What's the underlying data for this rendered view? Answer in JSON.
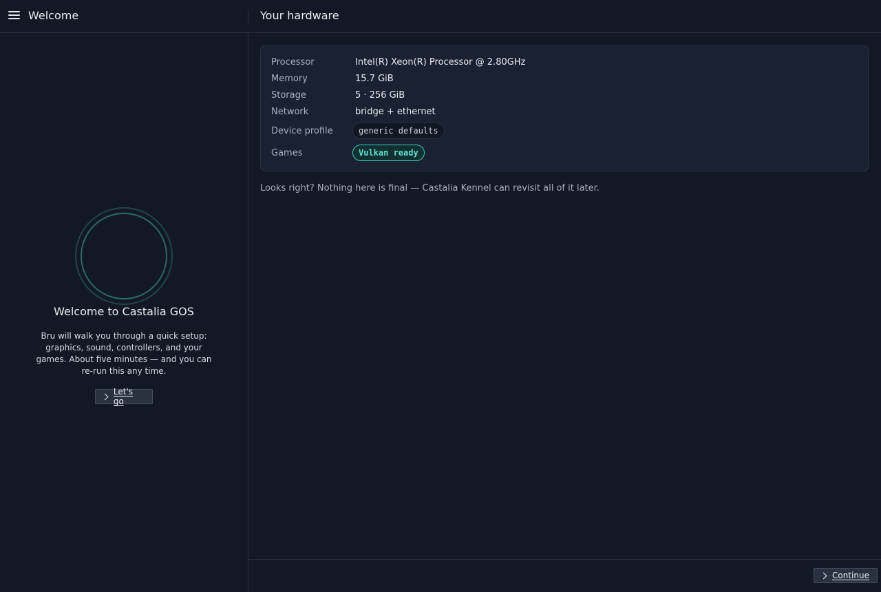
{
  "header": {
    "left_title": "Welcome",
    "right_title": "Your hardware"
  },
  "sidebar": {
    "title": "Welcome to Castalia GOS",
    "description": "Bru will walk you through a quick setup: graphics, sound, controllers, and your games. About five minutes — and you can re-run this any time.",
    "button_label": "Let's go"
  },
  "hardware": {
    "rows": [
      {
        "label": "Processor",
        "value": "Intel(R) Xeon(R) Processor @ 2.80GHz"
      },
      {
        "label": "Memory",
        "value": "15.7 GiB"
      },
      {
        "label": "Storage",
        "value": "5 · 256 GiB"
      },
      {
        "label": "Network",
        "value": "bridge + ethernet"
      }
    ],
    "device_profile": {
      "label": "Device profile",
      "value": "generic defaults"
    },
    "games": {
      "label": "Games",
      "value": "Vulkan ready"
    }
  },
  "hint": "Looks right? Nothing here is final — Castalia Kennel can revisit all of it later.",
  "footer": {
    "continue_label": "Continue"
  },
  "icons": {
    "menu": "hamburger-menu-icon",
    "chevron": "chevron-right-icon",
    "logo": "ring-logo-icon"
  },
  "colors": {
    "background": "#131924",
    "card": "#1a2130",
    "accent": "#3bd1c2",
    "logo_ring": "#2c6a68"
  }
}
